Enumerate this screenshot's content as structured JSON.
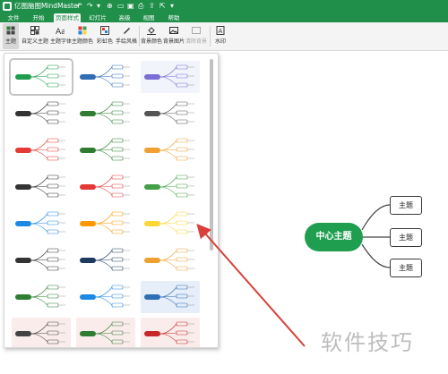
{
  "app": {
    "title": "亿图脑图MindMaster"
  },
  "menu": {
    "tabs": [
      {
        "label": "文件"
      },
      {
        "label": "开始"
      },
      {
        "label": "页面样式",
        "active": true
      },
      {
        "label": "幻灯片"
      },
      {
        "label": "高级"
      },
      {
        "label": "视图"
      },
      {
        "label": "帮助"
      }
    ]
  },
  "ribbon": {
    "theme": "主题",
    "custom_theme": "自定义主题",
    "theme_font": "主题字体",
    "theme_color": "主题颜色",
    "rainbow": "彩虹色",
    "hand_drawn": "手绘风格",
    "bg_color": "背景颜色",
    "bg_image": "背景图片",
    "clear_bg": "清除背景",
    "watermark": "水印"
  },
  "mindmap": {
    "central_topic": "中心主题",
    "subtopics": [
      "主题",
      "主题",
      "主题"
    ]
  },
  "watermark_text": "软件技巧",
  "colors": {
    "brand": "#1f8f4a",
    "central_topic": "#1e9e4e",
    "arrow": "#d9403a"
  },
  "icons": {
    "logo": "mindmaster-logo",
    "undo": "undo-icon",
    "redo": "redo-icon",
    "save": "save-icon",
    "open": "open-icon",
    "print": "print-icon",
    "export": "export-icon"
  }
}
